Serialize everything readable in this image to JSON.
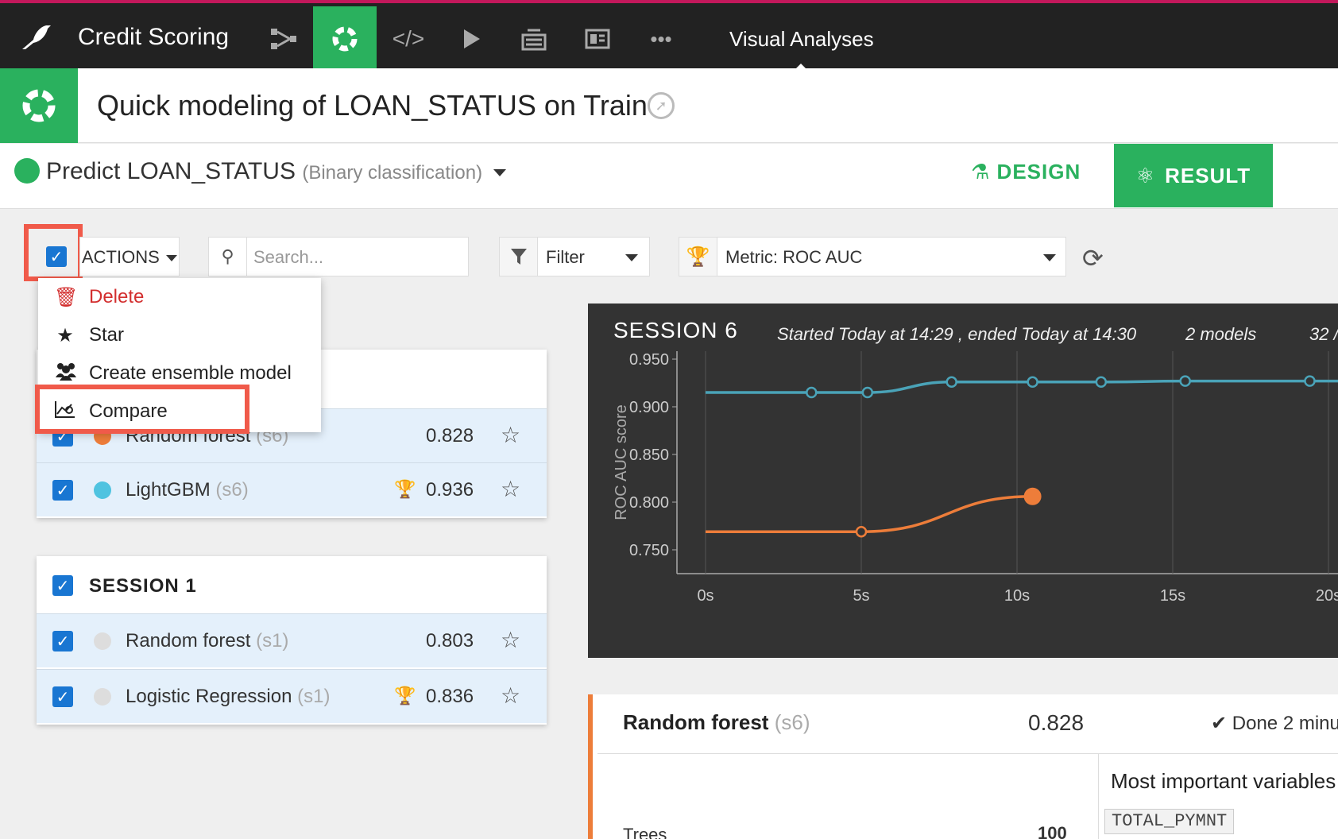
{
  "nav": {
    "project": "Credit Scoring",
    "section": "Visual Analyses",
    "icons": [
      "flow-icon",
      "lab-icon",
      "code-icon",
      "run-icon",
      "deploy-icon",
      "dashboard-icon",
      "more-icon"
    ]
  },
  "title": {
    "text": "Quick modeling of LOAN_STATUS on Train"
  },
  "subheader": {
    "predict": "Predict LOAN_STATUS",
    "type": "(Binary classification)",
    "design": "DESIGN",
    "result": "RESULT"
  },
  "toolbar": {
    "actions": "ACTIONS",
    "search_placeholder": "Search...",
    "filter": "Filter",
    "metric": "Metric: ROC AUC"
  },
  "menu": {
    "items": [
      "Delete",
      "Star",
      "Create ensemble model",
      "Compare"
    ]
  },
  "session6": {
    "rows": [
      {
        "name": "Random forest",
        "session": "(s6)",
        "score": "0.828",
        "color": "#ed7d3a",
        "best": false
      },
      {
        "name": "LightGBM",
        "session": "(s6)",
        "score": "0.936",
        "color": "#4fc3e0",
        "best": true
      }
    ]
  },
  "session1": {
    "label": "SESSION 1",
    "rows": [
      {
        "name": "Random forest",
        "session": "(s1)",
        "score": "0.803",
        "color": "#dddddd",
        "best": false
      },
      {
        "name": "Logistic Regression",
        "session": "(s1)",
        "score": "0.836",
        "color": "#dddddd",
        "best": true
      }
    ]
  },
  "chart_panel": {
    "title": "SESSION 6",
    "started": "Started Today at 14:29 , ended Today at 14:30",
    "models": "2 models",
    "extra": "32 /"
  },
  "chart_data": {
    "type": "line",
    "ylabel": "ROC AUC score",
    "xlabel": "",
    "yticks": [
      "0.950",
      "0.900",
      "0.850",
      "0.800",
      "0.750"
    ],
    "xticks": [
      "0s",
      "5s",
      "10s",
      "15s",
      "20s"
    ],
    "ylim": [
      0.725,
      0.95
    ],
    "xlim": [
      0,
      20
    ],
    "series": [
      {
        "color": "#4aa3b8",
        "points": [
          [
            0,
            0.915
          ],
          [
            3.4,
            0.915
          ],
          [
            5.2,
            0.915
          ],
          [
            7.9,
            0.926
          ],
          [
            10.5,
            0.926
          ],
          [
            12.7,
            0.926
          ],
          [
            15.4,
            0.927
          ],
          [
            19.4,
            0.927
          ],
          [
            20.5,
            0.927
          ]
        ],
        "end_marker": false
      },
      {
        "color": "#ed7d3a",
        "points": [
          [
            0,
            0.769
          ],
          [
            5,
            0.769
          ],
          [
            10.5,
            0.806
          ]
        ],
        "end_marker": true
      }
    ]
  },
  "detail": {
    "name": "Random forest",
    "session": "(s6)",
    "score": "0.828",
    "status": "Done 2 minu",
    "important_title": "Most important variables",
    "important_first": "TOTAL_PYMNT",
    "row_label": "Trees",
    "row_value": "100"
  }
}
